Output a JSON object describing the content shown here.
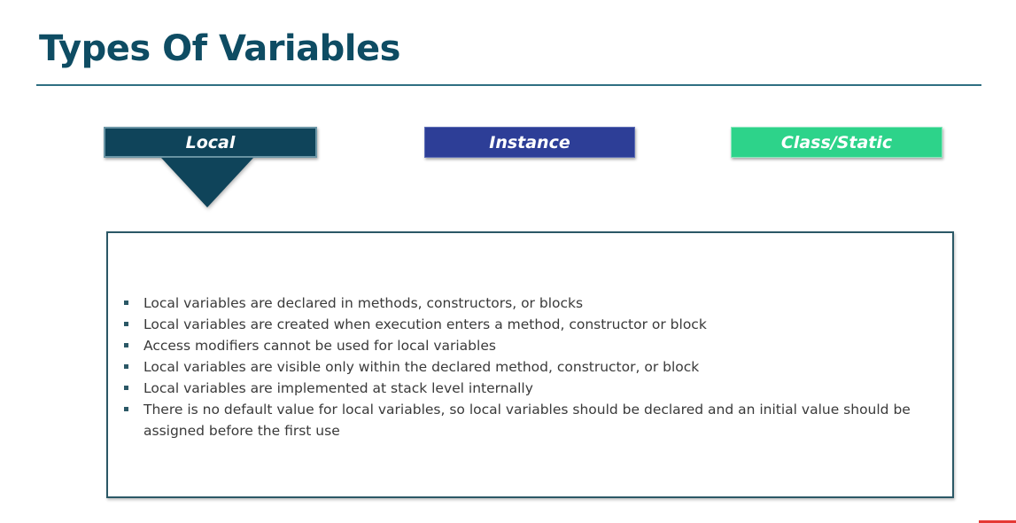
{
  "slide": {
    "title": "Types Of Variables",
    "tabs": [
      {
        "label": "Local",
        "color": "#0f445a",
        "selected": true
      },
      {
        "label": "Instance",
        "color": "#2d3e97",
        "selected": false
      },
      {
        "label": "Class/Static",
        "color": "#2dd38a",
        "selected": false
      }
    ],
    "bullets": [
      "Local variables are declared in methods, constructors, or blocks",
      "Local variables are created when execution enters a method, constructor or block",
      "Access modifiers cannot be used for local variables",
      "Local variables are visible only within the declared method, constructor, or block",
      "Local variables are implemented at stack level internally",
      "There is no default value for local variables, so local variables should be declared and an initial value should be assigned before the first use"
    ],
    "colors": {
      "title": "#0e4c63",
      "rule": "#2f6f82",
      "box_border": "#2b5866",
      "accent_red": "#e53935"
    }
  }
}
